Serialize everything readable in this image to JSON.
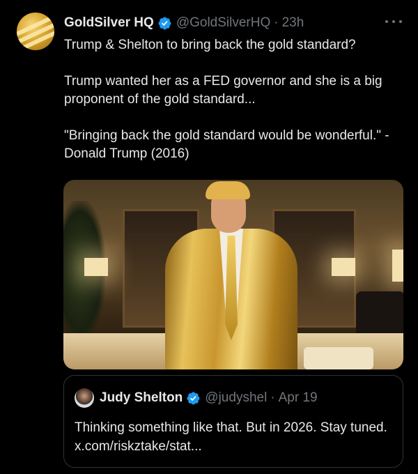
{
  "tweet": {
    "author_name": "GoldSilver HQ",
    "author_handle": "@GoldSilverHQ",
    "separator": "·",
    "time": "23h",
    "lines": [
      "Trump & Shelton to bring back the gold standard?",
      "Trump wanted her as a FED governor and she is a big proponent of the gold standard...",
      "\"Bringing back the gold standard would be wonderful.\" - Donald Trump (2016)"
    ]
  },
  "quoted_tweet": {
    "author_name": "Judy Shelton",
    "author_handle": "@judyshel",
    "separator": "·",
    "time": "Apr 19",
    "text": "Thinking something like that. But in 2026. Stay tuned. x.com/riskztake/stat..."
  },
  "colors": {
    "background": "#000000",
    "text": "#e7e9ea",
    "secondary": "#71767b",
    "verified": "#1d9bf0",
    "border": "#2f3336"
  },
  "icons": [
    "verified-badge-icon",
    "more-options-icon"
  ]
}
